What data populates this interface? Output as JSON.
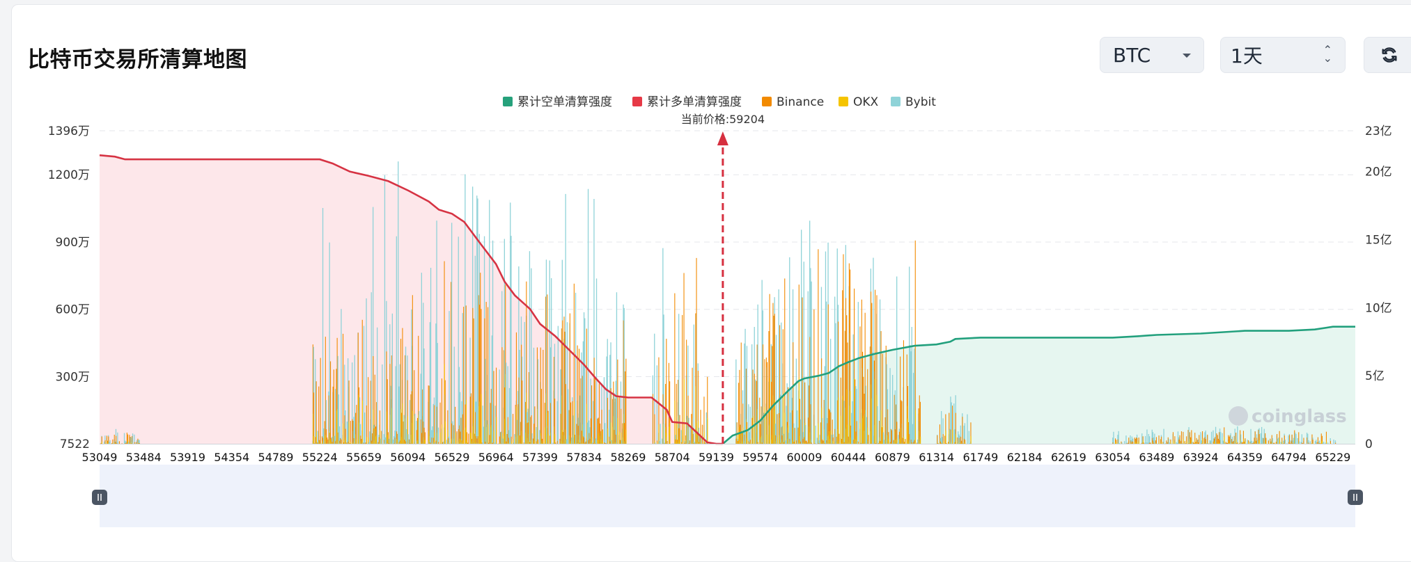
{
  "header": {
    "title": "比特币交易所清算地图",
    "symbol_select": "BTC",
    "range_select": "1天"
  },
  "chart_data": {
    "type": "bar",
    "legend": [
      {
        "name": "累计空单清算强度",
        "color": "#26a17b"
      },
      {
        "name": "累计多单清算强度",
        "color": "#e63946"
      },
      {
        "name": "Binance",
        "color": "#f28a00"
      },
      {
        "name": "OKX",
        "color": "#f5c400"
      },
      {
        "name": "Bybit",
        "color": "#8fd3d8"
      }
    ],
    "current_price_label": "当前价格:59204",
    "current_price": 59204,
    "x_ticks": [
      "53049",
      "53484",
      "53919",
      "54354",
      "54789",
      "55224",
      "55659",
      "56094",
      "56529",
      "56964",
      "57399",
      "57834",
      "58269",
      "58704",
      "59139",
      "59574",
      "60009",
      "60444",
      "60879",
      "61314",
      "61749",
      "62184",
      "62619",
      "63054",
      "63489",
      "63924",
      "64359",
      "64794",
      "65229"
    ],
    "left_axis_ticks": [
      "7522",
      "300万",
      "600万",
      "900万",
      "1200万",
      "1396万"
    ],
    "right_axis_ticks": [
      "0",
      "5亿",
      "10亿",
      "15亿",
      "20亿",
      "23亿"
    ],
    "xlim": [
      53049,
      65450
    ],
    "left_ylim": [
      7522,
      13960000
    ],
    "right_ylim": [
      0,
      23
    ],
    "long_cumulative_curve": {
      "name": "累计多单清算强度",
      "unit": "亿",
      "x": [
        53049,
        53200,
        53300,
        54500,
        55224,
        55350,
        55520,
        55700,
        55900,
        56100,
        56300,
        56400,
        56529,
        56650,
        56800,
        56964,
        57050,
        57150,
        57300,
        57400,
        57550,
        57700,
        57834,
        57950,
        58050,
        58150,
        58269,
        58500,
        58550,
        58650,
        58704,
        58850,
        58950,
        59050,
        59139,
        59204
      ],
      "y": [
        21.2,
        21.1,
        20.9,
        20.9,
        20.9,
        20.6,
        20.0,
        19.7,
        19.3,
        18.6,
        17.8,
        17.2,
        16.9,
        16.3,
        14.8,
        13.2,
        11.9,
        10.9,
        9.9,
        8.8,
        7.9,
        6.8,
        5.8,
        4.8,
        4.0,
        3.5,
        3.4,
        3.4,
        3.1,
        2.5,
        1.6,
        1.5,
        0.8,
        0.1,
        0.0,
        0.0
      ]
    },
    "short_cumulative_curve": {
      "name": "累计空单清算强度",
      "unit": "亿",
      "x": [
        59204,
        59300,
        59450,
        59574,
        59700,
        59850,
        59950,
        60009,
        60150,
        60250,
        60350,
        60444,
        60550,
        60700,
        60879,
        61100,
        61314,
        61450,
        61500,
        61749,
        62184,
        62619,
        63054,
        63300,
        63489,
        63924,
        64359,
        64794,
        65050,
        65229,
        65450
      ],
      "y": [
        0.0,
        0.6,
        1.0,
        1.7,
        2.8,
        3.9,
        4.6,
        4.8,
        5.0,
        5.2,
        5.7,
        6.0,
        6.3,
        6.6,
        6.9,
        7.2,
        7.3,
        7.5,
        7.7,
        7.8,
        7.8,
        7.8,
        7.8,
        7.9,
        8.0,
        8.1,
        8.3,
        8.3,
        8.4,
        8.6,
        8.6
      ]
    },
    "liquidation_bars_overview": {
      "note": "Bybit (teal) bars dominate; Binance (orange) and OKX (yellow) overlaid",
      "dense_regions": [
        {
          "from": 55150,
          "to": 58250,
          "peak_bybit": 12800000,
          "peak_binance": 9000000
        },
        {
          "from": 58500,
          "to": 59050,
          "peak_bybit": 9500000,
          "peak_binance": 8800000
        },
        {
          "from": 59330,
          "to": 61150,
          "peak_bybit": 10300000,
          "peak_binance": 9300000
        },
        {
          "from": 61300,
          "to": 61650,
          "peak_bybit": 2400000,
          "peak_binance": 2100000
        },
        {
          "from": 63050,
          "to": 65250,
          "peak_bybit": 800000,
          "peak_binance": 750000
        }
      ],
      "sparse_regions": [
        {
          "from": 53049,
          "to": 53450,
          "peak_bybit": 700000,
          "peak_binance": 650000
        }
      ]
    },
    "watermark": "coinglass"
  }
}
